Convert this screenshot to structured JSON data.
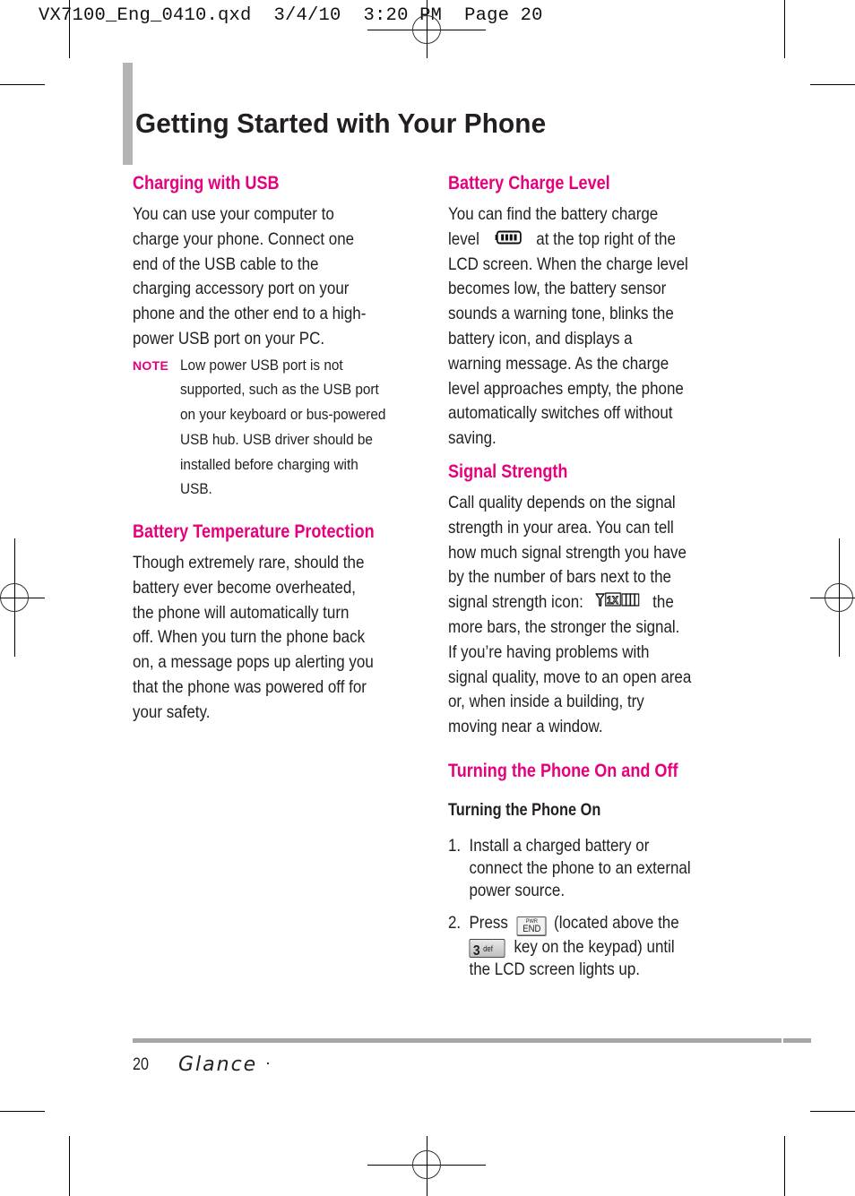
{
  "slug_line": "VX7100_Eng_0410.qxd  3/4/10  3:20 PM  Page 20",
  "page_title": "Getting Started with Your Phone",
  "left_column": {
    "charging_usb": {
      "heading": "Charging with USB",
      "body": "You can use your computer to charge your phone. Connect one end of the USB cable to the charging accessory port on your phone and the other end to a high-power USB port on your PC.",
      "lines": [
        "You can use your computer to",
        "charge your phone. Connect one",
        "end of the USB cable to the",
        "charging accessory port on your",
        "phone and the other end to a high-",
        "power USB port on your PC."
      ],
      "note_label": "NOTE",
      "note_lines": [
        "Low power USB port is not",
        "supported, such as the USB port",
        "on your keyboard or bus-powered",
        "USB hub. USB driver should be",
        "installed before charging with",
        "USB."
      ]
    },
    "battery_temp": {
      "heading": "Battery Temperature Protection",
      "lines": [
        "Though extremely rare, should the",
        "battery ever become overheated,",
        "the phone will automatically turn",
        "off. When you turn the phone back",
        "on, a message pops up alerting you",
        "that the phone was powered off for",
        "your safety."
      ]
    }
  },
  "right_column": {
    "battery_level": {
      "heading": "Battery Charge Level",
      "line1": "You can find the battery charge",
      "line2_pre": "level",
      "line2_post": "at the top right of the",
      "lines_rest": [
        "LCD screen. When the charge level",
        "becomes low, the battery sensor",
        "sounds a warning tone, blinks the",
        "battery icon, and displays a",
        "warning message. As the charge",
        "level approaches empty, the phone",
        "automatically switches off without",
        "saving."
      ],
      "battery_icon": "battery-full-icon"
    },
    "signal": {
      "heading": "Signal Strength",
      "lines_pre": [
        "Call quality depends on the signal",
        "strength in your area. You can tell",
        "how much signal strength you have",
        "by the number of bars next to the"
      ],
      "icon_line_pre": "signal strength icon:",
      "icon_line_post": "the",
      "lines_post": [
        "more bars, the stronger the signal.",
        "If you’re having problems with",
        "signal quality, move to an open area",
        "or, when inside a building, try",
        "moving near a window."
      ],
      "signal_icon": "signal-1x-icon",
      "signal_icon_text": "1X"
    },
    "power": {
      "heading": "Turning the Phone On and Off",
      "subheading": "Turning the Phone On",
      "steps": [
        {
          "num": "1.",
          "lines": [
            "Install a charged battery or",
            "connect the phone to an external",
            "power source."
          ]
        },
        {
          "num": "2.",
          "press": "Press",
          "after_end_key": "(located above the",
          "after_3_key": "key on the keypad) until",
          "last_line": "the LCD screen lights up."
        }
      ],
      "end_key": {
        "top": "PWR",
        "label": "END"
      },
      "three_key": {
        "digit": "3",
        "letters": "def"
      }
    }
  },
  "footer": {
    "page_number": "20",
    "brand": "Glance"
  }
}
